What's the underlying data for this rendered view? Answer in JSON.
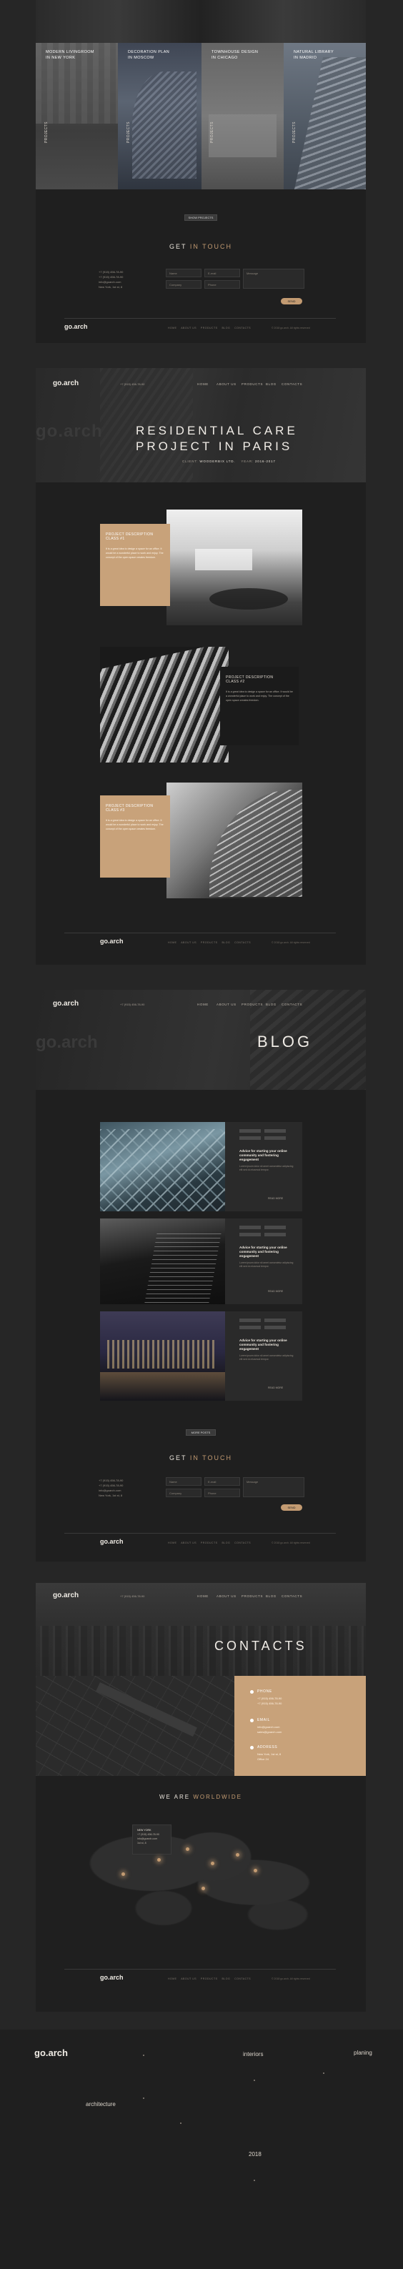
{
  "colors": {
    "accent": "#c39b72",
    "bg": "#262626",
    "panel": "#1f1f1f"
  },
  "top": {
    "projects": [
      {
        "title": "MODERN LIVINGROOM\nIN NEW YORK",
        "side": "PROJECTS"
      },
      {
        "title": "DECORATION PLAN\nIN MOSCOW",
        "side": "PROJECTS"
      },
      {
        "title": "TOWNHOUSE DESIGN\nIN CHICAGO",
        "side": "PROJECTS"
      },
      {
        "title": "NATURAL LIBRARY\nIN MADRID",
        "side": "PROJECTS"
      }
    ],
    "show_more": "SHOW PROJECTS"
  },
  "contact_form": {
    "title_a": "GET",
    "title_b": "IN TOUCH",
    "info": [
      "+7 (915) 456-78-90",
      "+7 (915) 456-78-90",
      "info@goarch.com",
      "New York, 1st st, 8"
    ],
    "name_ph": "Name",
    "email_ph": "E-mail",
    "company_ph": "Company",
    "phone_ph": "Phone",
    "message_ph": "Message",
    "send": "SEND"
  },
  "footer": {
    "logo": "go.arch",
    "links": [
      "HOME",
      "ABOUT US",
      "PRODUCTS",
      "BLOG",
      "CONTACTS"
    ],
    "copyright": "© 2018 go.arch. All rights reserved"
  },
  "nav": {
    "logo": "go.arch",
    "phone": "+7 (915) 456-78-90",
    "items": [
      "HOME",
      "ABOUT US",
      "PRODUCTS",
      "BLOG",
      "CONTACTS"
    ]
  },
  "project_page": {
    "title_line1": "RESIDENTIAL CARE",
    "title_line2": "PROJECT IN PARIS",
    "client_label": "CLIENT:",
    "client": "WOODERBIX LTD.",
    "year_label": "YEAR:",
    "year": "2016-2017",
    "watermark": "go.arch",
    "descriptions": [
      {
        "heading": "PROJECT DESCRIPTION\nCLASS #1",
        "body": "It is a great idea to design a space for an office. It would be a wonderful place to work and enjoy. The concept of the open space creates freedom."
      },
      {
        "heading": "PROJECT DESCRIPTION\nCLASS #2",
        "body": "It is a great idea to design a space for an office. It would be a wonderful place to work and enjoy. The concept of the open space creates freedom."
      },
      {
        "heading": "PROJECT DESCRIPTION\nCLASS #3",
        "body": "It is a great idea to design a space for an office. It would be a wonderful place to work and enjoy. The concept of the open space creates freedom."
      }
    ]
  },
  "blog_page": {
    "title": "BLOG",
    "watermark": "go.arch",
    "posts": [
      {
        "title": "Advice for starting your online community and fostering engagement",
        "excerpt": "Lorem ipsum dolor sit amet consectetur adipiscing elit sed do eiusmod tempor.",
        "more": "READ MORE"
      },
      {
        "title": "Advice for starting your online community and fostering engagement",
        "excerpt": "Lorem ipsum dolor sit amet consectetur adipiscing elit sed do eiusmod tempor.",
        "more": "READ MORE"
      },
      {
        "title": "Advice for starting your online community and fostering engagement",
        "excerpt": "Lorem ipsum dolor sit amet consectetur adipiscing elit sed do eiusmod tempor.",
        "more": "READ MORE"
      }
    ],
    "more_btn": "MORE POSTS"
  },
  "contacts_page": {
    "title": "CONTACTS",
    "blocks": [
      {
        "label": "PHONE",
        "lines": [
          "+7 (915) 456-78-90",
          "+7 (915) 456-78-90"
        ]
      },
      {
        "label": "EMAIL",
        "lines": [
          "info@goarch.com",
          "sales@goarch.com"
        ]
      },
      {
        "label": "ADDRESS",
        "lines": [
          "New York, 1st st, 8",
          "Office 24"
        ]
      }
    ],
    "worldwide_a": "WE ARE",
    "worldwide_b": "WORLDWIDE",
    "popup": [
      "NEW YORK",
      "+7 (915) 456-78-90",
      "info@goarch.com",
      "1st st, 8"
    ]
  },
  "bottom": {
    "logo": "go.arch",
    "words": [
      "interiors",
      "planing",
      "architecture",
      "2018"
    ]
  }
}
